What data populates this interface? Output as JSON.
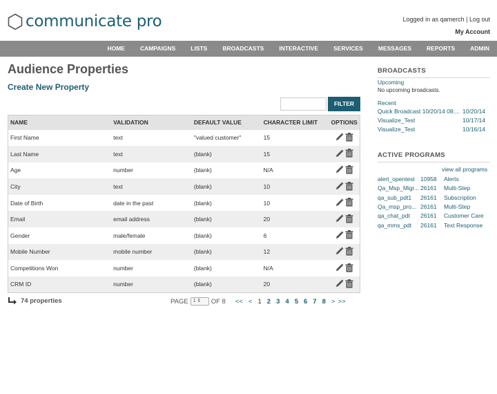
{
  "header": {
    "brand": "communicate pro",
    "logged_in_as": "Logged in as qamerch",
    "separator": "|",
    "logout": "Log out",
    "my_account": "My Account"
  },
  "nav": [
    "HOME",
    "CAMPAIGNS",
    "LISTS",
    "BROADCASTS",
    "INTERACTIVE",
    "SERVICES",
    "MESSAGES",
    "REPORTS",
    "ADMIN"
  ],
  "main": {
    "title": "Audience Properties",
    "create_link": "Create New Property",
    "filter_value": "",
    "filter_button": "FILTER",
    "columns": [
      "NAME",
      "VALIDATION",
      "DEFAULT VALUE",
      "CHARACTER LIMIT",
      "OPTIONS"
    ],
    "rows": [
      [
        "First Name",
        "text",
        "\"valued customer\"",
        "15"
      ],
      [
        "Last Name",
        "text",
        "(blank)",
        "15"
      ],
      [
        "Age",
        "number",
        "(blank)",
        "N/A"
      ],
      [
        "City",
        "text",
        "(blank)",
        "10"
      ],
      [
        "Date of Birth",
        "date in the past",
        "(blank)",
        "10"
      ],
      [
        "Email",
        "email address",
        "(blank)",
        "20"
      ],
      [
        "Gender",
        "male/female",
        "(blank)",
        "6"
      ],
      [
        "Mobile Number",
        "mobile number",
        "(blank)",
        "12"
      ],
      [
        "Competitions Won",
        "number",
        "(blank)",
        "N/A"
      ],
      [
        "CRM ID",
        "number",
        "(blank)",
        "20"
      ]
    ],
    "count_text": "74 properties",
    "pager": {
      "label": "PAGE",
      "current": "1",
      "of_text": "OF 8",
      "first": "<<",
      "prev": "<",
      "pages": [
        "1",
        "2",
        "3",
        "4",
        "5",
        "6",
        "7",
        "8"
      ],
      "next": ">",
      "last": ">>"
    }
  },
  "sidebar": {
    "broadcasts_heading": "BROADCASTS",
    "upcoming_label": "Upcoming",
    "upcoming_empty": "No upcoming broadcasts.",
    "recent_label": "Recent",
    "recent": [
      {
        "name": "Quick Broadcast 10/20/14 08:...",
        "date": "10/20/14"
      },
      {
        "name": "Visualize_Test",
        "date": "10/17/14"
      },
      {
        "name": "Visualize_Test",
        "date": "10/16/14"
      }
    ],
    "programs_heading": "ACTIVE PROGRAMS",
    "view_all": "view all programs",
    "programs": [
      {
        "name": "alert_opentest",
        "code": "10958",
        "type": "Alerts"
      },
      {
        "name": "Qa_Msp_Migr...",
        "code": "26161",
        "type": "Multi-Step"
      },
      {
        "name": "qa_sub_pdt1",
        "code": "26161",
        "type": "Subscription"
      },
      {
        "name": "Qa_msp_pro...",
        "code": "26161",
        "type": "Multi-Step"
      },
      {
        "name": "qa_chat_pdt",
        "code": "26161",
        "type": "Customer Care"
      },
      {
        "name": "qa_mms_pdt",
        "code": "26161",
        "type": "Text Response"
      }
    ]
  },
  "icons": {
    "edit": "pencil-icon",
    "delete": "trash-icon",
    "logo": "hexagon-logo-icon"
  },
  "colors": {
    "brand": "#1d5e73",
    "nav_bg": "#8a8a8a",
    "row_alt": "#eeeeee",
    "header_bg": "#e3e3e3"
  }
}
